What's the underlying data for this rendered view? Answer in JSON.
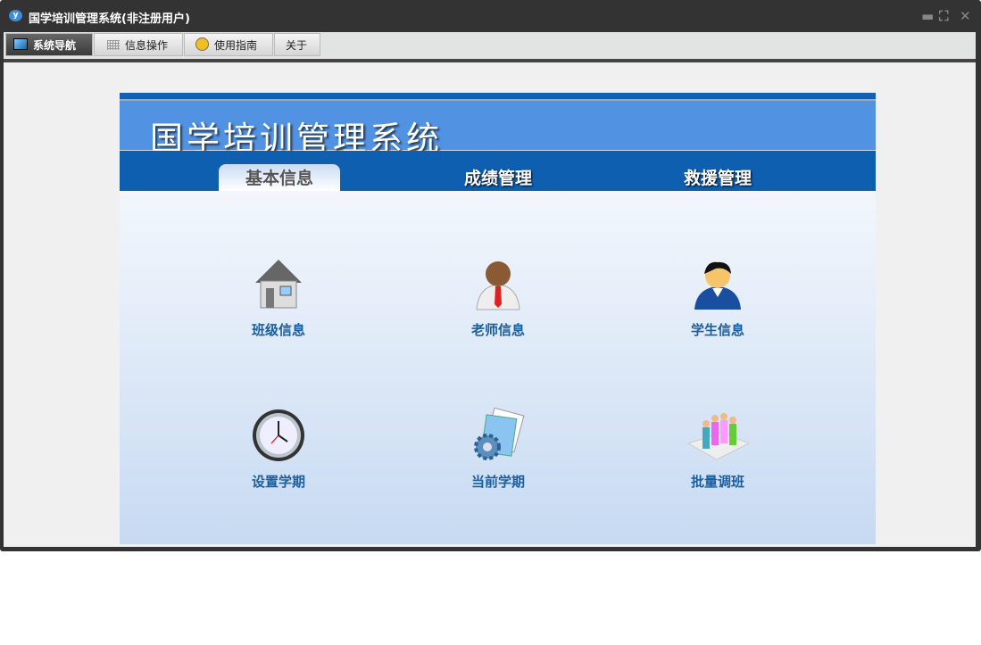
{
  "window": {
    "title": "国学培训管理系统(非注册用户)",
    "controls": [
      "minimize",
      "restore",
      "close"
    ]
  },
  "tabs": [
    {
      "label": "系统导航",
      "icon": "monitor-icon",
      "active": true
    },
    {
      "label": "信息操作",
      "icon": "grid-icon"
    },
    {
      "label": "使用指南",
      "icon": "help-icon"
    },
    {
      "label": "关于"
    }
  ],
  "banner": {
    "title": "国学培训管理系统"
  },
  "nav": [
    {
      "label": "基本信息",
      "active": true
    },
    {
      "label": "成绩管理"
    },
    {
      "label": "救援管理"
    }
  ],
  "items": [
    {
      "label": "班级信息",
      "icon": "house-icon"
    },
    {
      "label": "老师信息",
      "icon": "teacher-icon"
    },
    {
      "label": "学生信息",
      "icon": "student-icon"
    },
    {
      "label": "设置学期",
      "icon": "clock-icon"
    },
    {
      "label": "当前学期",
      "icon": "document-gear-icon"
    },
    {
      "label": "批量调班",
      "icon": "group-icon"
    }
  ]
}
